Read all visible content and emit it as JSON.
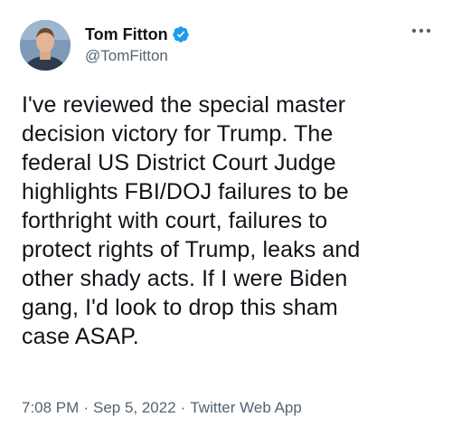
{
  "author": {
    "display_name": "Tom Fitton",
    "handle": "@TomFitton",
    "verified": true
  },
  "icons": {
    "verified": "verified-badge-icon",
    "more": "more-options-icon"
  },
  "colors": {
    "verified_blue": "#1d9bf0",
    "secondary_text": "#536471",
    "primary_text": "#0f1419"
  },
  "tweet": {
    "text": "I've reviewed the special master\ndecision victory for Trump. The\nfederal US District Court Judge\nhighlights FBI/DOJ failures to be\nforthright with court, failures to\nprotect rights of Trump, leaks and\nother shady acts. If I were Biden\ngang, I'd look to drop this sham\ncase ASAP.",
    "time": "7:08 PM",
    "date": "Sep 5, 2022",
    "source": "Twitter Web App",
    "separator": "·"
  }
}
